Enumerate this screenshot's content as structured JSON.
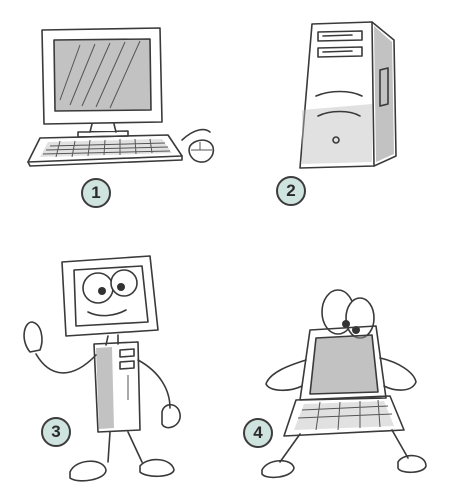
{
  "steps": [
    {
      "number": "1",
      "subject": "desktop-computer"
    },
    {
      "number": "2",
      "subject": "computer-tower"
    },
    {
      "number": "3",
      "subject": "computer-character-standing"
    },
    {
      "number": "4",
      "subject": "computer-character-squatting"
    }
  ],
  "colors": {
    "badge_fill": "#cfe3df",
    "ink": "#3a3a3a",
    "paper": "#ffffff"
  }
}
